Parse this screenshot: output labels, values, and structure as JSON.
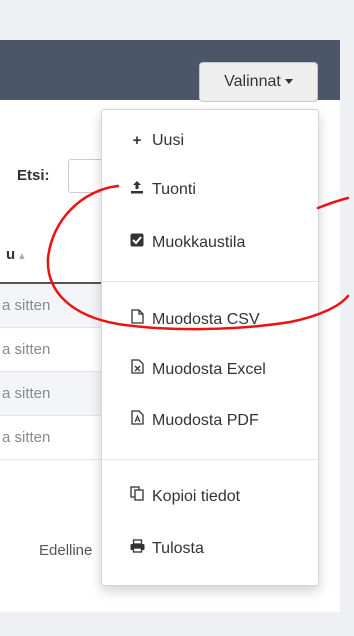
{
  "toolbar": {
    "options_label": "Valinnat"
  },
  "search": {
    "label": "Etsi:",
    "placeholder": ""
  },
  "table": {
    "partial_header": "u",
    "rows": [
      "a sitten",
      "a sitten",
      "a sitten",
      "a sitten"
    ]
  },
  "pagination": {
    "previous_partial": "Edelline"
  },
  "menu": {
    "items": [
      {
        "label": "Uusi",
        "icon": "plus-icon"
      },
      {
        "label": "Tuonti",
        "icon": "upload-icon"
      },
      {
        "label": "Muokkaustila",
        "icon": "checkbox-icon"
      },
      {
        "label": "Muodosta CSV",
        "icon": "file-icon"
      },
      {
        "label": "Muodosta Excel",
        "icon": "file-excel-icon"
      },
      {
        "label": "Muodosta PDF",
        "icon": "file-pdf-icon"
      },
      {
        "label": "Kopioi tiedot",
        "icon": "copy-icon"
      },
      {
        "label": "Tulosta",
        "icon": "print-icon"
      }
    ]
  },
  "colors": {
    "header": "#4c5669",
    "annotation": "#ee1111",
    "background": "#eef0f3"
  }
}
